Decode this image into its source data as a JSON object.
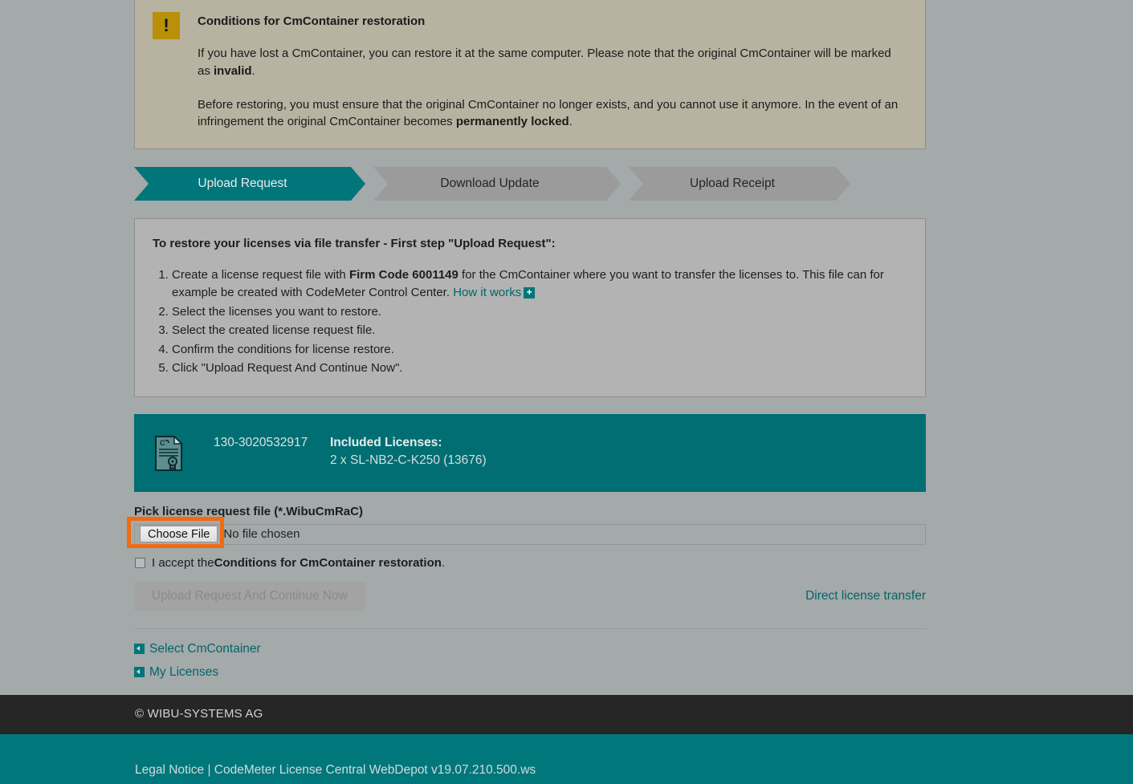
{
  "conditions": {
    "icon": "warning-exclamation-icon",
    "title": "Conditions for CmContainer restoration",
    "paragraph1_pre": "If you have lost a CmContainer, you can restore it at the same computer. Please note that the original CmContainer will be marked as ",
    "paragraph1_bold": "invalid",
    "paragraph1_post": ".",
    "paragraph2_pre": "Before restoring, you must ensure that the original CmContainer no longer exists, and you cannot use it anymore. In the event of an infringement the original CmContainer becomes ",
    "paragraph2_bold": "permanently locked",
    "paragraph2_post": "."
  },
  "steps": [
    {
      "label": "Upload Request",
      "state": "active"
    },
    {
      "label": "Download Update",
      "state": "inactive"
    },
    {
      "label": "Upload Receipt",
      "state": "inactive"
    }
  ],
  "instructions": {
    "title": "To restore your licenses via file transfer - First step \"Upload Request\":",
    "items": [
      {
        "text_pre": "Create a license request file with ",
        "bold": "Firm Code 6001149",
        "text_post": " for the CmContainer where you want to transfer the licenses to. This file can for example be created with CodeMeter Control Center. ",
        "link": "How it works",
        "link_badge": "+"
      },
      {
        "text_pre": "Select the licenses you want to restore."
      },
      {
        "text_pre": "Select the created license request file."
      },
      {
        "text_pre": "Confirm the conditions for license restore."
      },
      {
        "text_pre": "Click \"Upload Request And Continue Now\"."
      }
    ]
  },
  "license_panel": {
    "icon": "license-certificate-icon",
    "serial": "130-3020532917",
    "included_label": "Included Licenses:",
    "included_value": "2 x SL-NB2-C-K250 (13676)"
  },
  "file_picker": {
    "label": "Pick license request file (*.WibuCmRaC)",
    "button": "Choose File",
    "status": "No file chosen",
    "highlighted": true
  },
  "accept": {
    "text_pre": "I accept the ",
    "bold": "Conditions for CmContainer restoration",
    "text_post": ".",
    "checked": false
  },
  "actions": {
    "upload_button": "Upload Request And Continue Now",
    "upload_button_disabled": true,
    "direct_link": "Direct license transfer"
  },
  "back_links": [
    {
      "label": "Select CmContainer",
      "icon": "back-arrow-icon"
    },
    {
      "label": "My Licenses",
      "icon": "back-arrow-icon"
    }
  ],
  "footer": {
    "copyright": "© WIBU-SYSTEMS AG",
    "legal": "Legal Notice | CodeMeter License Central WebDepot v19.07.210.500.ws"
  },
  "colors": {
    "page_background": "#a4a9aa",
    "teal": "#006e73",
    "teal_link": "#00666b",
    "warning_beige": "#b8b2a1",
    "warning_gold": "#b8900a",
    "panel_gray": "#b3b3b3",
    "highlight_orange": "#f26a11",
    "footer_dark": "#262626"
  }
}
